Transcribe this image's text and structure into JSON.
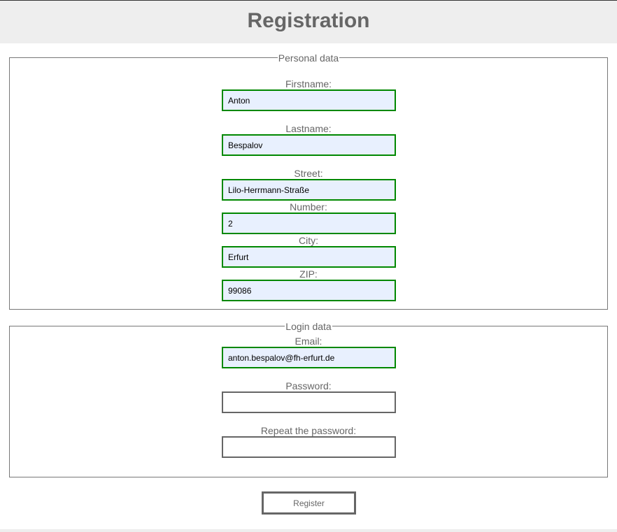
{
  "header": {
    "title": "Registration"
  },
  "personal": {
    "legend": "Personal data",
    "firstname": {
      "label": "Firstname:",
      "value": "Anton"
    },
    "lastname": {
      "label": "Lastname:",
      "value": "Bespalov"
    },
    "street": {
      "label": "Street:",
      "value": "Lilo-Herrmann-Straße"
    },
    "number": {
      "label": "Number:",
      "value": "2"
    },
    "city": {
      "label": "City:",
      "value": "Erfurt"
    },
    "zip": {
      "label": "ZIP:",
      "value": "99086"
    }
  },
  "login": {
    "legend": "Login data",
    "email": {
      "label": "Email:",
      "value": "anton.bespalov@fh-erfurt.de"
    },
    "password": {
      "label": "Password:",
      "value": ""
    },
    "repeat": {
      "label": "Repeat the password:",
      "value": ""
    }
  },
  "register_label": "Register",
  "colors": {
    "valid_border": "#008000",
    "autofill_bg": "#e8f0fe",
    "text": "#666666"
  }
}
